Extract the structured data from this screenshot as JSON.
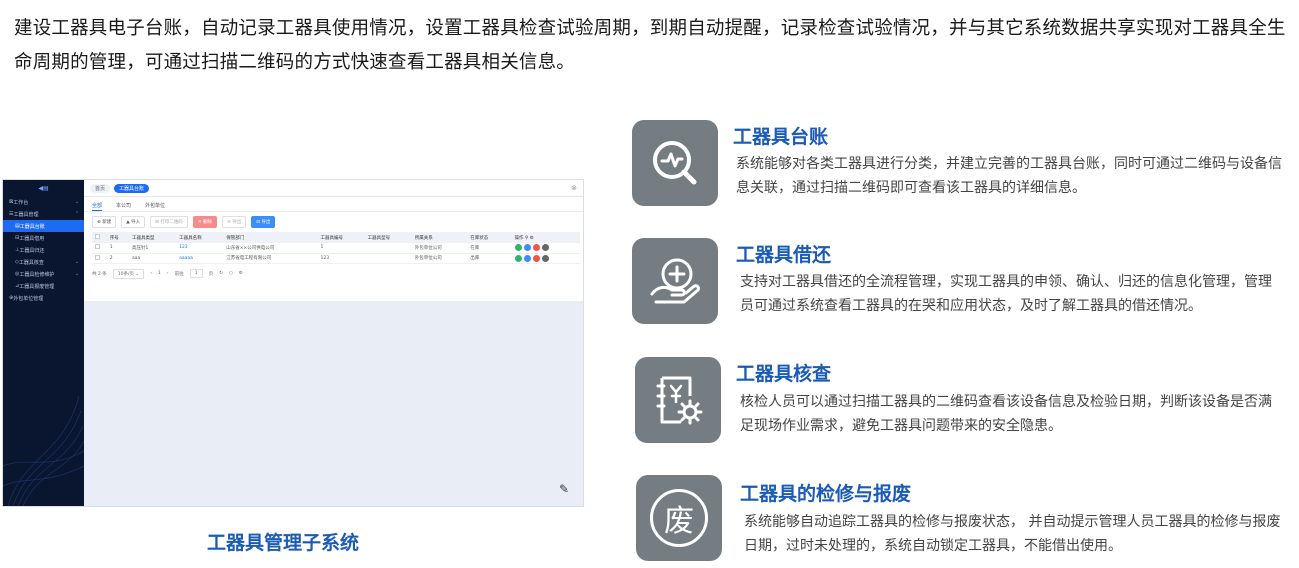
{
  "intro": "建设工器具电子台账，自动记录工器具使用情况，设置工器具检查试验周期，到期自动提醒，记录检查试验情况，并与其它系统数据共享实现对工器具全生命周期的管理，可通过扫描二维码的方式快速查看工器具相关信息。",
  "screenshot": {
    "sidebar": {
      "items": [
        {
          "label": "工作台"
        },
        {
          "label": "工器具管理"
        },
        {
          "label": "工器具台账"
        },
        {
          "label": "工器具借用"
        },
        {
          "label": "工器具归还"
        },
        {
          "label": "工器具核查"
        },
        {
          "label": "工器具检修维护"
        },
        {
          "label": "工器具报废管理"
        },
        {
          "label": "外包单位管理"
        }
      ]
    },
    "top_tags": [
      "首页",
      "工器具台账"
    ],
    "tabs": [
      "全部",
      "本公司",
      "外包单位"
    ],
    "buttons": [
      "新建",
      "导入",
      "打印二维码",
      "删除",
      "导出",
      "导出"
    ],
    "columns": [
      "",
      "序号",
      "工器具类型",
      "工器具名称",
      "保管部门",
      "工器具编号",
      "工器具型号",
      "所属关系",
      "在库状态",
      "",
      "操作"
    ],
    "rows": [
      [
        "",
        "1",
        "高压针1",
        "123",
        "山东省××公司供电公司",
        "1",
        "",
        "外包单位公司",
        "在库",
        ""
      ],
      [
        "",
        "2",
        "aaa",
        "aaaaa",
        "江苏省电工程有限公司",
        "123",
        "",
        "外包单位公司",
        "出库",
        ""
      ]
    ],
    "pager": {
      "total": "共 2 条",
      "page_size": "10条/页",
      "current": "1",
      "goto_label": "前往",
      "goto_value": "1",
      "page_suffix": "页"
    }
  },
  "caption": "工器具管理子系统",
  "features": [
    {
      "icon": "search-chart-icon",
      "title": "工器具台账",
      "desc": "系统能够对各类工器具进行分类，并建立完善的工器具台账，同时可通过二维码与设备信息关联，通过扫描二维码即可查看该工器具的详细信息。"
    },
    {
      "icon": "hand-plus-icon",
      "title": "工器具借还",
      "desc": "支持对工器具借还的全流程管理，实现工器具的申领、确认、归还的信息化管理，管理员可通过系统查看工器具的在哭和应用状态，及时了解工器具的借还情况。"
    },
    {
      "icon": "document-gear-icon",
      "title": "工器具核查",
      "desc": "核检人员可以通过扫描工器具的二维码查看该设备信息及检验日期，判断该设备是否满足现场作业需求，避免工器具问题带来的安全隐患。"
    },
    {
      "icon": "scrap-seal-icon",
      "title": "工器具的检修与报废",
      "glyph": "废",
      "desc": "系统能够自动追踪工器具的检修与报废状态， 并自动提示管理人员工器具的检修与报废日期，过时未处理的，系统自动锁定工器具，不能借出使用。"
    }
  ],
  "colors": {
    "accent": "#1b5bb8",
    "icon_bg": "#757d82",
    "sidebar_bg": "#0a1630",
    "primary": "#1d6bf3"
  }
}
